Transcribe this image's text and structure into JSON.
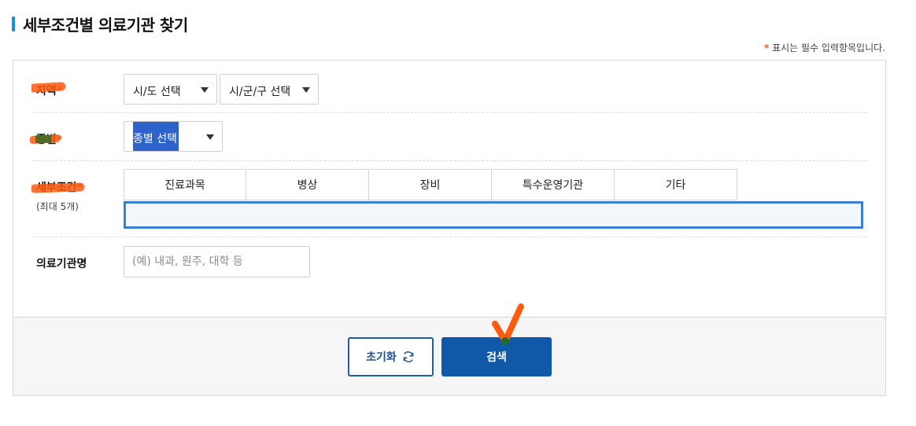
{
  "title": "세부조건별 의료기관 찾기",
  "required_note": {
    "star": "*",
    "text": " 표시는 필수 입력항목입니다."
  },
  "fields": {
    "region": {
      "label": "지역",
      "star": "*",
      "sido_select": "시/도 선택",
      "sigungu_select": "시/군/구 선택"
    },
    "type": {
      "label": "종별",
      "star": "*",
      "select": "종별 선택"
    },
    "conditions": {
      "label": "세부조건",
      "star": "*",
      "sub": "(최대 5개)",
      "tabs": [
        "진료과목",
        "병상",
        "장비",
        "특수운영기관",
        "기타"
      ]
    },
    "hospital_name": {
      "label": "의료기관명",
      "placeholder": "(예) 내과, 원주, 대학 등"
    }
  },
  "buttons": {
    "reset": "초기화",
    "search": "검색"
  },
  "colors": {
    "accent": "#1b8fd9",
    "required_star": "#e85a0c",
    "search_button": "#1158a8",
    "tab_content_border": "#3b7fd1"
  }
}
